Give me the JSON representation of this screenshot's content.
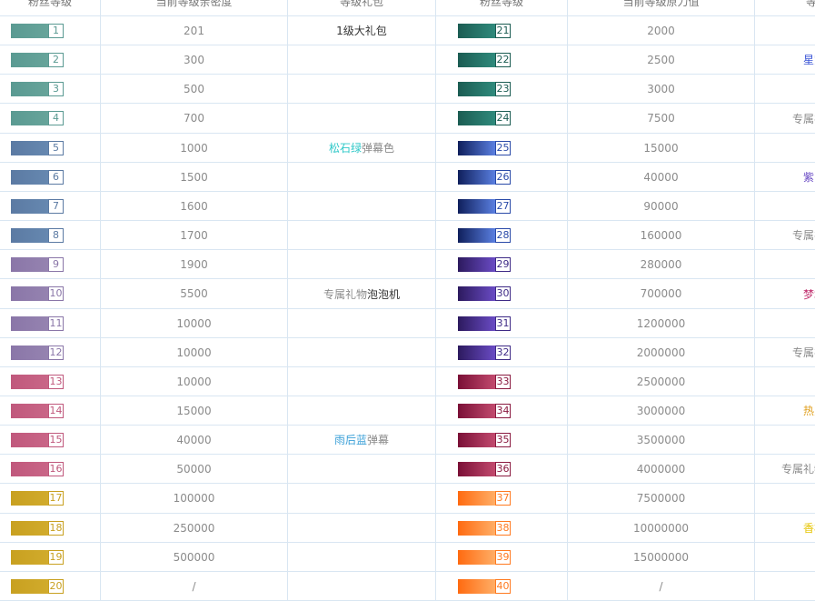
{
  "headers": [
    "粉丝等级",
    "当前等级亲密度",
    "等级礼包",
    "粉丝等级",
    "当前等级原力值",
    "等"
  ],
  "tiers": {
    "teal": {
      "bar": "linear-gradient(90deg,#5a9a92,#67a49a)",
      "border": "#5a9a92",
      "text": "#5a9a92"
    },
    "blue": {
      "bar": "linear-gradient(90deg,#5b7aa3,#6688b0)",
      "border": "#5b7aa3",
      "text": "#5b7aa3"
    },
    "purple": {
      "bar": "linear-gradient(90deg,#8a76a8,#9583b0)",
      "border": "#8a76a8",
      "text": "#8a76a8"
    },
    "pink": {
      "bar": "linear-gradient(90deg,#c0587c,#c96687)",
      "border": "#c0587c",
      "text": "#c0587c"
    },
    "gold": {
      "bar": "linear-gradient(90deg,#c8a020,#d1ab2c)",
      "border": "#c8a020",
      "text": "#c8a020"
    },
    "dteal": {
      "bar": "linear-gradient(90deg,#1b5c52,#2f8a7c)",
      "border": "#1b5c52",
      "text": "#1b5c52"
    },
    "navy": {
      "bar": "linear-gradient(90deg,#0f1f5c,#5a7fe0)",
      "border": "#2a4aa8",
      "text": "#2a4aa8"
    },
    "violet": {
      "bar": "linear-gradient(90deg,#2c1a5e,#6a4bc4)",
      "border": "#3e2a86",
      "text": "#3e2a86"
    },
    "crimson": {
      "bar": "linear-gradient(90deg,#7a0f36,#c24a6e)",
      "border": "#8a1a40",
      "text": "#8a1a40"
    },
    "orange": {
      "bar": "linear-gradient(90deg,#ff6a10,#ffae66)",
      "border": "#ff7a20",
      "text": "#ff7a20"
    }
  },
  "rows": [
    {
      "l": "1",
      "lt": "teal",
      "intimacy": "201",
      "gift": [
        {
          "t": "1级大礼包",
          "c": "#333333"
        }
      ],
      "r": "21",
      "rt": "dteal",
      "force": "2000",
      "extra": []
    },
    {
      "l": "2",
      "lt": "teal",
      "intimacy": "300",
      "gift": [],
      "r": "22",
      "rt": "dteal",
      "force": "2500",
      "extra": [
        {
          "t": "星空",
          "c": "#3b55d6"
        }
      ]
    },
    {
      "l": "3",
      "lt": "teal",
      "intimacy": "500",
      "gift": [],
      "r": "23",
      "rt": "dteal",
      "force": "3000",
      "extra": []
    },
    {
      "l": "4",
      "lt": "teal",
      "intimacy": "700",
      "gift": [],
      "r": "24",
      "rt": "dteal",
      "force": "7500",
      "extra": [
        {
          "t": "专属礼",
          "c": "#8b8b8b"
        }
      ]
    },
    {
      "l": "5",
      "lt": "blue",
      "intimacy": "1000",
      "gift": [
        {
          "t": "松石绿",
          "c": "#2ec8c8"
        },
        {
          "t": "弹幕色",
          "c": "#8b8b8b"
        }
      ],
      "r": "25",
      "rt": "navy",
      "force": "15000",
      "extra": []
    },
    {
      "l": "6",
      "lt": "blue",
      "intimacy": "1500",
      "gift": [],
      "r": "26",
      "rt": "navy",
      "force": "40000",
      "extra": [
        {
          "t": "紫罗",
          "c": "#6a4bc4"
        }
      ]
    },
    {
      "l": "7",
      "lt": "blue",
      "intimacy": "1600",
      "gift": [],
      "r": "27",
      "rt": "navy",
      "force": "90000",
      "extra": []
    },
    {
      "l": "8",
      "lt": "blue",
      "intimacy": "1700",
      "gift": [],
      "r": "28",
      "rt": "navy",
      "force": "160000",
      "extra": [
        {
          "t": "专属礼",
          "c": "#8b8b8b"
        }
      ]
    },
    {
      "l": "9",
      "lt": "purple",
      "intimacy": "1900",
      "gift": [],
      "r": "29",
      "rt": "violet",
      "force": "280000",
      "extra": []
    },
    {
      "l": "10",
      "lt": "purple",
      "intimacy": "5500",
      "gift": [
        {
          "t": "专属礼物",
          "c": "#8b8b8b"
        },
        {
          "t": "泡泡机",
          "c": "#333333"
        }
      ],
      "r": "30",
      "rt": "violet",
      "force": "700000",
      "extra": [
        {
          "t": "梦境",
          "c": "#c0306e"
        }
      ]
    },
    {
      "l": "11",
      "lt": "purple",
      "intimacy": "10000",
      "gift": [],
      "r": "31",
      "rt": "violet",
      "force": "1200000",
      "extra": []
    },
    {
      "l": "12",
      "lt": "purple",
      "intimacy": "10000",
      "gift": [],
      "r": "32",
      "rt": "violet",
      "force": "2000000",
      "extra": [
        {
          "t": "专属礼",
          "c": "#8b8b8b"
        }
      ]
    },
    {
      "l": "13",
      "lt": "pink",
      "intimacy": "10000",
      "gift": [],
      "r": "33",
      "rt": "crimson",
      "force": "2500000",
      "extra": []
    },
    {
      "l": "14",
      "lt": "pink",
      "intimacy": "15000",
      "gift": [],
      "r": "34",
      "rt": "crimson",
      "force": "3000000",
      "extra": [
        {
          "t": "热力",
          "c": "#e0a020"
        }
      ]
    },
    {
      "l": "15",
      "lt": "pink",
      "intimacy": "40000",
      "gift": [
        {
          "t": "雨后蓝",
          "c": "#3aa0d8"
        },
        {
          "t": "弹幕",
          "c": "#8b8b8b"
        }
      ],
      "r": "35",
      "rt": "crimson",
      "force": "3500000",
      "extra": []
    },
    {
      "l": "16",
      "lt": "pink",
      "intimacy": "50000",
      "gift": [],
      "r": "36",
      "rt": "crimson",
      "force": "4000000",
      "extra": [
        {
          "t": "专属礼物",
          "c": "#8b8b8b"
        }
      ]
    },
    {
      "l": "17",
      "lt": "gold",
      "intimacy": "100000",
      "gift": [],
      "r": "37",
      "rt": "orange",
      "force": "7500000",
      "extra": []
    },
    {
      "l": "18",
      "lt": "gold",
      "intimacy": "250000",
      "gift": [],
      "r": "38",
      "rt": "orange",
      "force": "10000000",
      "extra": [
        {
          "t": "香槟",
          "c": "#e6c400"
        }
      ]
    },
    {
      "l": "19",
      "lt": "gold",
      "intimacy": "500000",
      "gift": [],
      "r": "39",
      "rt": "orange",
      "force": "15000000",
      "extra": []
    },
    {
      "l": "20",
      "lt": "gold",
      "intimacy": "/",
      "gift": [],
      "r": "40",
      "rt": "orange",
      "force": "/",
      "extra": []
    }
  ]
}
